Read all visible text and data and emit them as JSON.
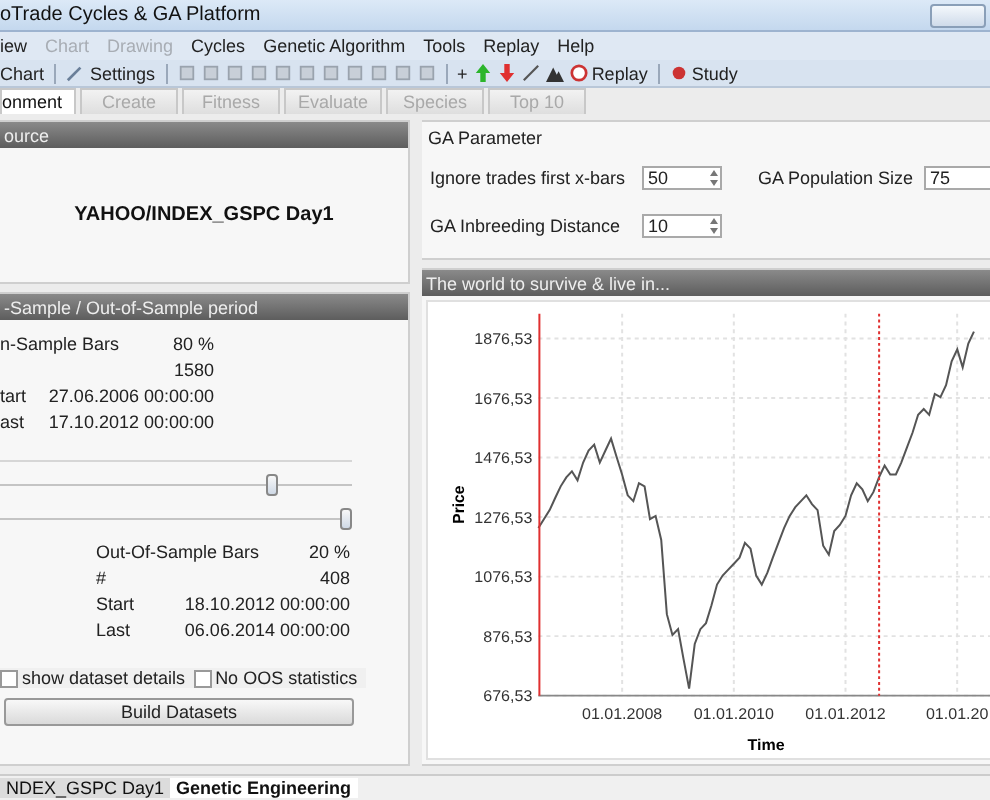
{
  "window": {
    "title": "oTrade Cycles & GA Platform"
  },
  "menu": [
    {
      "label": "iew",
      "disabled": false
    },
    {
      "label": "Chart",
      "disabled": true
    },
    {
      "label": "Drawing",
      "disabled": true
    },
    {
      "label": "Cycles",
      "disabled": false
    },
    {
      "label": "Genetic Algorithm",
      "disabled": false
    },
    {
      "label": "Tools",
      "disabled": false
    },
    {
      "label": "Replay",
      "disabled": false
    },
    {
      "label": "Help",
      "disabled": false
    }
  ],
  "toolbar": {
    "chart_button": "Chart",
    "settings_button": "Settings",
    "add_button": "+",
    "replay_button": "Replay",
    "study_button": "Study"
  },
  "tabs": [
    {
      "label": "onment",
      "selected": true
    },
    {
      "label": "Create",
      "selected": false
    },
    {
      "label": "Fitness",
      "selected": false
    },
    {
      "label": "Evaluate",
      "selected": false
    },
    {
      "label": "Species",
      "selected": false
    },
    {
      "label": "Top 10",
      "selected": false
    }
  ],
  "source": {
    "title": "ource",
    "dataset": "YAHOO/INDEX_GSPC Day1"
  },
  "sample": {
    "title": "-Sample / Out-of-Sample period",
    "in_sample": [
      {
        "label": "n-Sample Bars",
        "value": "80 %"
      },
      {
        "value": "1580"
      },
      {
        "label": "tart",
        "value": "27.06.2006 00:00:00"
      },
      {
        "label": "ast",
        "value": "17.10.2012 00:00:00"
      }
    ],
    "sliders": [
      {
        "level": 0.78
      },
      {
        "level": 1
      }
    ],
    "out_of_sample": [
      {
        "label": "Out-Of-Sample Bars",
        "value": "20 %"
      },
      {
        "label": "#",
        "value": "408"
      },
      {
        "label": "Start",
        "value": "18.10.2012 00:00:00"
      },
      {
        "label": "Last",
        "value": "06.06.2014 00:00:00"
      }
    ],
    "checkboxes": [
      {
        "label": "show dataset details",
        "checked": false
      },
      {
        "label": "No OOS statistics",
        "checked": false
      }
    ],
    "button": "Build Datasets"
  },
  "ga_parameters": {
    "title": "GA Parameter",
    "fields": [
      {
        "label": "Ignore trades first x-bars",
        "value": "50"
      },
      {
        "label": "GA Population Size",
        "value": "75"
      },
      {
        "label": "GA Inbreeding Distance",
        "value": "10"
      }
    ]
  },
  "chart_panel": {
    "title": "The world to survive & live in...",
    "chart_data": {
      "type": "line",
      "xlabel": "Time",
      "ylabel": "Price",
      "categories": [
        null,
        null,
        null,
        null,
        null,
        null,
        null,
        null,
        null,
        null,
        null,
        null,
        null,
        null,
        null,
        "01.01.2008",
        null,
        null,
        null,
        null,
        null,
        null,
        null,
        null,
        null,
        null,
        null,
        null,
        null,
        null,
        null,
        null,
        null,
        null,
        null,
        "01.01.2010",
        null,
        null,
        null,
        null,
        null,
        null,
        null,
        null,
        null,
        null,
        null,
        null,
        null,
        null,
        null,
        null,
        null,
        null,
        null,
        "01.01.2012",
        null,
        null,
        null,
        null,
        null,
        null,
        null,
        null,
        null,
        null,
        null,
        null,
        null,
        null,
        null,
        null,
        null,
        null,
        null,
        "01.01.20",
        null,
        null,
        null
      ],
      "series": [
        {
          "color": "#555555",
          "values": [
            1240,
            1270,
            1300,
            1340,
            1380,
            1410,
            1430,
            1400,
            1460,
            1500,
            1520,
            1460,
            1500,
            1540,
            1480,
            1420,
            1350,
            1330,
            1390,
            1380,
            1270,
            1280,
            1200,
            950,
            880,
            900,
            800,
            700,
            850,
            900,
            920,
            980,
            1050,
            1080,
            1100,
            1120,
            1140,
            1190,
            1170,
            1080,
            1050,
            1090,
            1140,
            1190,
            1240,
            1280,
            1310,
            1330,
            1350,
            1320,
            1300,
            1180,
            1150,
            1230,
            1250,
            1280,
            1350,
            1390,
            1370,
            1330,
            1360,
            1410,
            1450,
            1420,
            1420,
            1460,
            1510,
            1560,
            1620,
            1640,
            1620,
            1690,
            1680,
            1720,
            1800,
            1840,
            1780,
            1860,
            1900
          ]
        }
      ],
      "ylim": [
        676.53,
        1960
      ],
      "yticks": [
        {
          "value": 676.53,
          "label": "676,53"
        },
        {
          "value": 876.53,
          "label": "876,53"
        },
        {
          "value": 1076.53,
          "label": "1076,53"
        },
        {
          "value": 1276.53,
          "label": "1276,53"
        },
        {
          "value": 1476.53,
          "label": "1476,53"
        },
        {
          "value": 1676.53,
          "label": "1676,53"
        },
        {
          "value": 1876.53,
          "label": "1876,53"
        }
      ],
      "grid": true
    }
  },
  "bottom_tabs": [
    {
      "label": "NDEX_GSPC Day1",
      "selected": false
    },
    {
      "label": "Genetic Engineering",
      "selected": true
    }
  ]
}
